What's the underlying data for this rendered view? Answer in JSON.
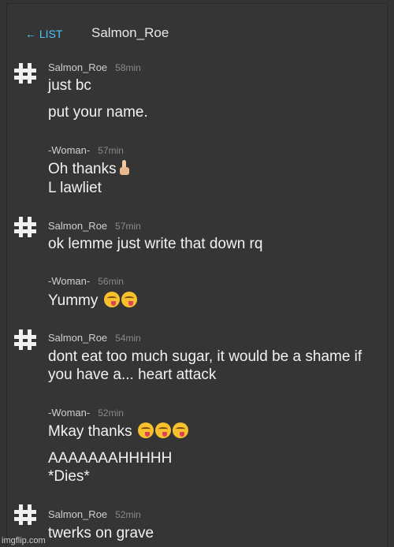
{
  "header": {
    "back_label": "← LIST",
    "title": "Salmon_Roe"
  },
  "messages": [
    {
      "author": "Salmon_Roe",
      "time": "58min",
      "avatar": "hash-avatar-icon",
      "lines": [
        "just bc",
        "put your name."
      ]
    },
    {
      "author": "-Woman-",
      "time": "57min",
      "lines": [
        "Oh thanks",
        "L lawliet"
      ],
      "emoji_after_first_line": "thumbs-up-icon"
    },
    {
      "author": "Salmon_Roe",
      "time": "57min",
      "avatar": "hash-avatar-icon",
      "lines": [
        "ok lemme just write that down rq"
      ]
    },
    {
      "author": "-Woman-",
      "time": "56min",
      "lines": [
        "Yummy"
      ],
      "emojis": [
        "yum-face-icon",
        "yum-face-icon"
      ]
    },
    {
      "author": "Salmon_Roe",
      "time": "54min",
      "avatar": "hash-avatar-icon",
      "lines": [
        "dont eat too much sugar, it would be a shame if",
        "you have a... heart attack"
      ]
    },
    {
      "author": "-Woman-",
      "time": "52min",
      "lines": [
        "Mkay thanks",
        "AAAAAAAHHHHH",
        "*Dies*"
      ],
      "emojis": [
        "yum-face-icon",
        "yum-face-icon",
        "yum-face-icon"
      ]
    },
    {
      "author": "Salmon_Roe",
      "time": "52min",
      "avatar": "hash-avatar-icon",
      "lines": [
        "twerks on grave"
      ]
    }
  ],
  "watermark": "imgflip.com"
}
